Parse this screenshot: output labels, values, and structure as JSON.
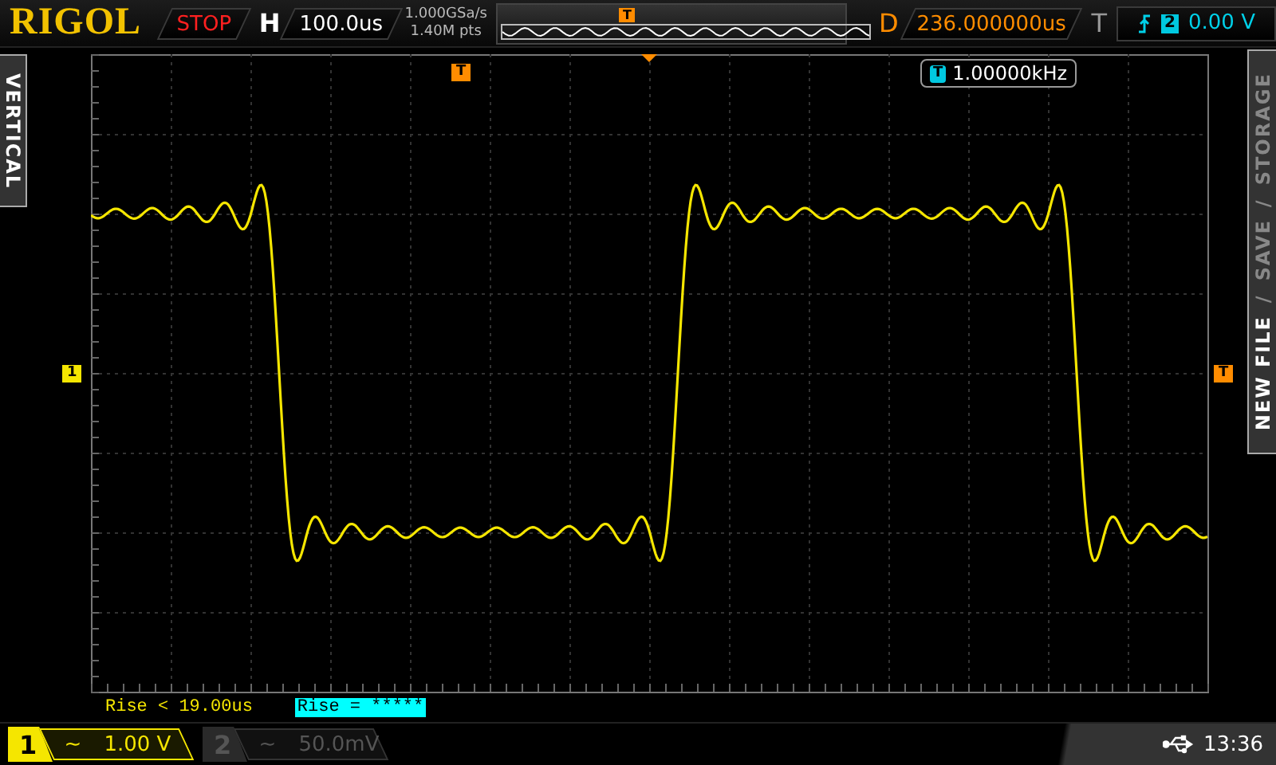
{
  "brand": "RIGOL",
  "run_state": "STOP",
  "horizontal": {
    "label": "H",
    "timebase": "100.0us"
  },
  "acquisition": {
    "sample_rate": "1.000GSa/s",
    "memory_depth": "1.40M pts"
  },
  "overview": {
    "trigger_marker": "T"
  },
  "delay": {
    "label": "D",
    "value": "236.000000us"
  },
  "trigger": {
    "label": "T",
    "source": "2",
    "trigger_level": "0.00 V"
  },
  "left_tab": {
    "label": "VERTICAL"
  },
  "right_menu": {
    "separator": "/",
    "items": [
      {
        "label": "NEW FILE",
        "selected": true
      },
      {
        "label": "SAVE",
        "selected": false
      },
      {
        "label": "STORAGE",
        "selected": false
      }
    ]
  },
  "graticule": {
    "trigger_position_marker": "T",
    "trigger_level_marker": "T",
    "channel_marker": "1"
  },
  "frequency": {
    "source_icon": "T",
    "value": "1.00000kHz"
  },
  "measurements": [
    {
      "text": "Rise < 19.00us",
      "highlighted": false
    },
    {
      "text": "Rise = *****",
      "highlighted": true
    }
  ],
  "channels": [
    {
      "number": "1",
      "coupling": "~",
      "scale": "1.00 V",
      "on": true
    },
    {
      "number": "2",
      "coupling": "~",
      "scale": "50.0mV",
      "on": false
    }
  ],
  "status_bar": {
    "time": "13:36"
  }
}
